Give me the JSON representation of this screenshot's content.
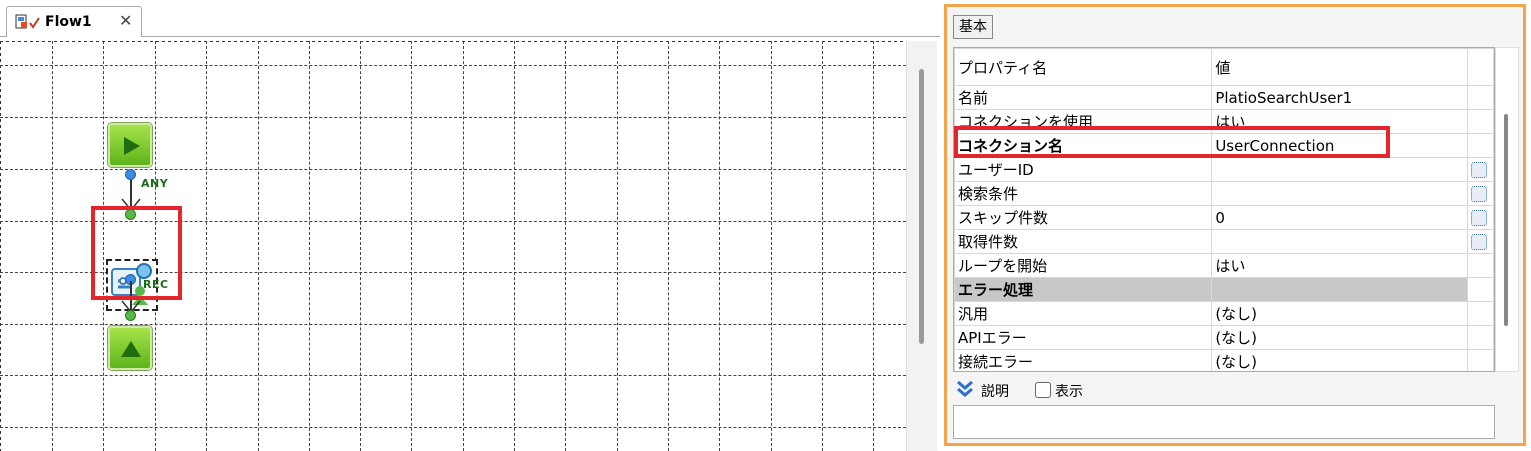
{
  "editor": {
    "tab_label": "Flow1",
    "tab_close": "✕"
  },
  "flow": {
    "port_any": "ANY",
    "port_rec": "REC"
  },
  "panel": {
    "tab_label": "基本",
    "header_name": "プロパティ名",
    "header_value": "値",
    "rows": [
      {
        "name": "名前",
        "value": "PlatioSearchUser1"
      },
      {
        "name": "コネクションを使用",
        "value": "はい"
      },
      {
        "name": "コネクション名",
        "value": "UserConnection"
      },
      {
        "name": "ユーザーID",
        "value": ""
      },
      {
        "name": "検索条件",
        "value": ""
      },
      {
        "name": "スキップ件数",
        "value": "0"
      },
      {
        "name": "取得件数",
        "value": ""
      },
      {
        "name": "ループを開始",
        "value": "はい"
      },
      {
        "name": "エラー処理",
        "value": ""
      },
      {
        "name": "汎用",
        "value": "(なし)"
      },
      {
        "name": "APIエラー",
        "value": "(なし)"
      },
      {
        "name": "接続エラー",
        "value": "(なし)"
      }
    ],
    "description_label": "説明",
    "show_label": "表示"
  },
  "colors": {
    "highlight": "#e3262c",
    "panel_border": "#f2a54a",
    "section_bg": "#c8c8c8"
  }
}
